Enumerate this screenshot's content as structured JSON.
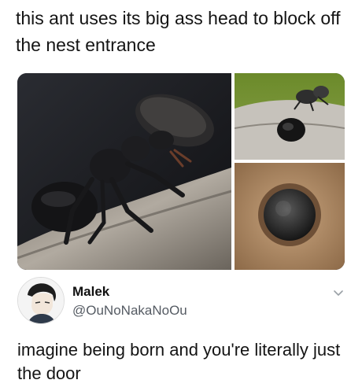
{
  "meme": {
    "caption": "this ant uses its big ass head to block off the nest entrance"
  },
  "images": {
    "main_photo": "ant-head-closeup",
    "top_right": "ant-on-branch-nest",
    "bottom_right": "nest-entrance-plugged"
  },
  "tweet": {
    "display_name": "Malek",
    "handle": "@OuNoNakaNoOu",
    "text": "imagine being born and you're literally just the door",
    "menu_icon": "chevron-down-icon"
  },
  "colors": {
    "text": "#141414",
    "handle": "#555b63",
    "chevron": "#9aa0a6"
  }
}
